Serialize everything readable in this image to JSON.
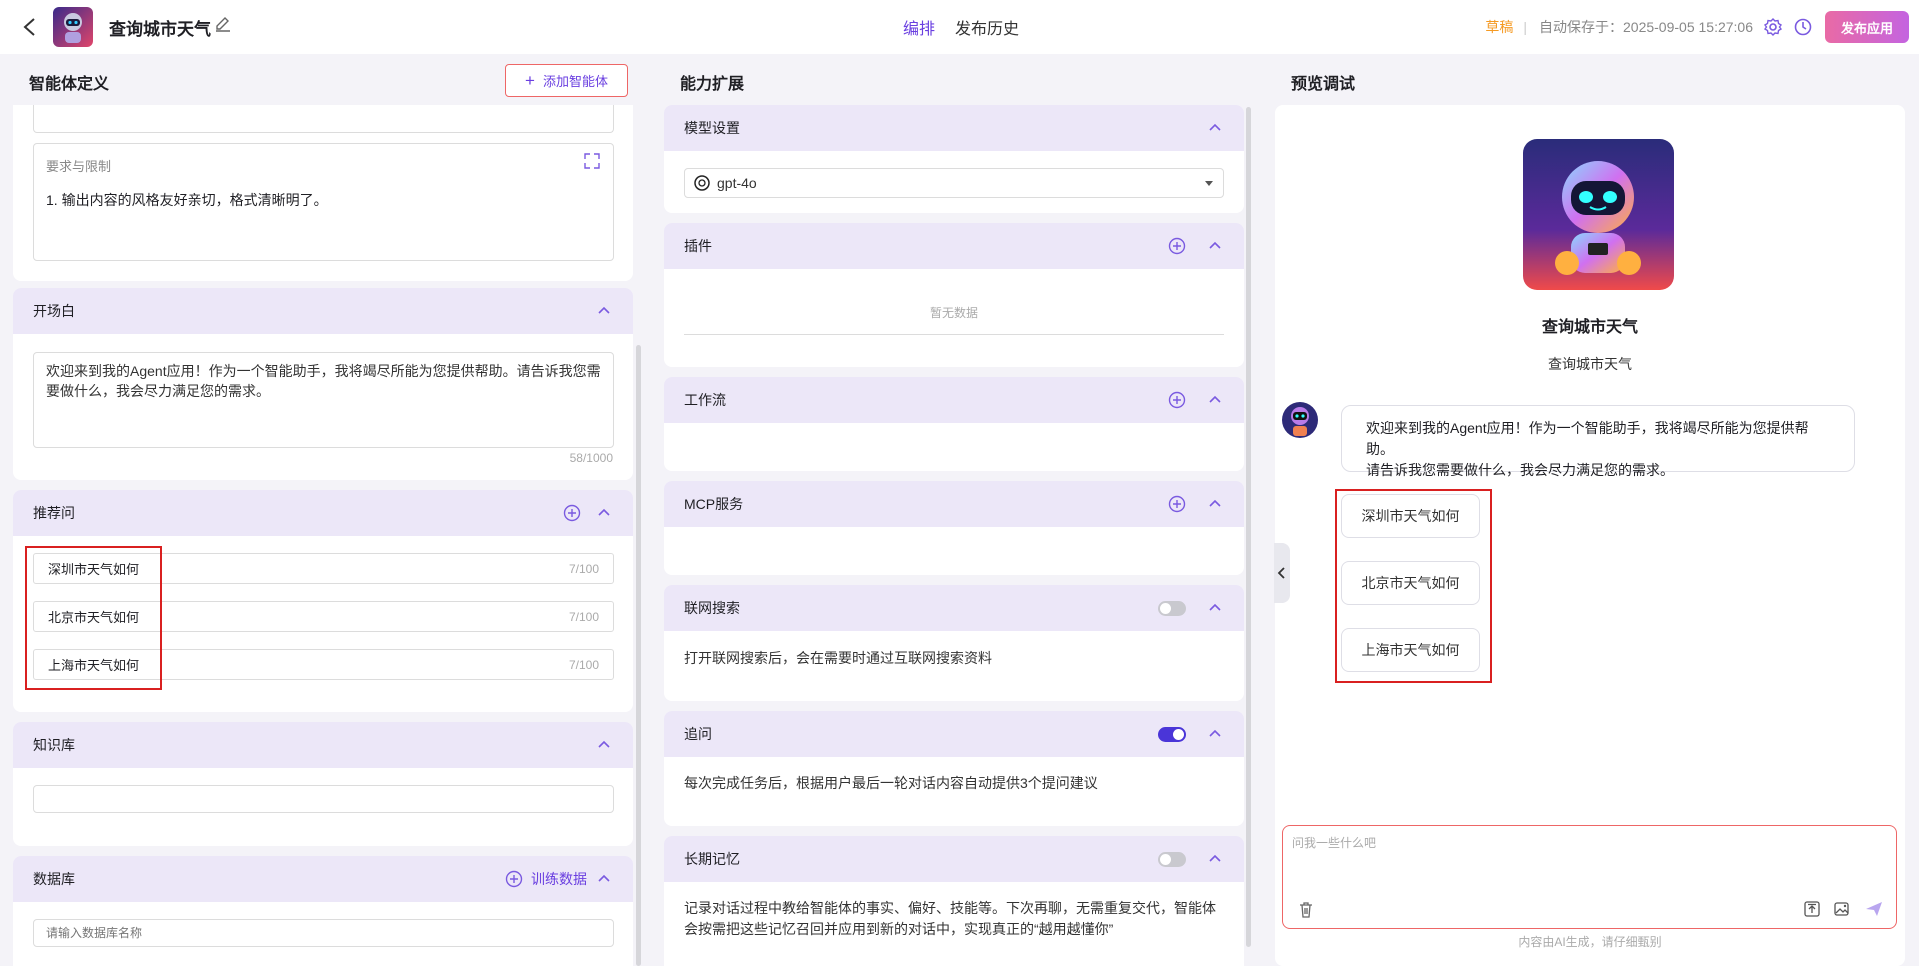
{
  "header": {
    "app_title": "查询城市天气",
    "tabs": [
      {
        "label": "编排",
        "active": true
      },
      {
        "label": "发布历史",
        "active": false
      }
    ],
    "draft": "草稿",
    "separator": "|",
    "autosave": "自动保存于：2025-09-05 15:27:06",
    "publish": "发布应用"
  },
  "left": {
    "title": "智能体定义",
    "add_agent": "添加智能体",
    "requirements_label": "要求与限制",
    "requirements_text": "1. 输出内容的风格友好亲切，格式清晰明了。",
    "opening": {
      "title": "开场白",
      "text": "欢迎来到我的Agent应用！作为一个智能助手，我将竭尽所能为您提供帮助。请告诉我您需要做什么，我会尽力满足您的需求。",
      "count": "58/1000"
    },
    "suggest": {
      "title": "推荐问",
      "items": [
        {
          "text": "深圳市天气如何",
          "count": "7/100"
        },
        {
          "text": "北京市天气如何",
          "count": "7/100"
        },
        {
          "text": "上海市天气如何",
          "count": "7/100"
        }
      ]
    },
    "knowledge": {
      "title": "知识库"
    },
    "database": {
      "title": "数据库",
      "train": "训练数据",
      "placeholder": "请输入数据库名称"
    }
  },
  "middle": {
    "title": "能力扩展",
    "model": {
      "title": "模型设置",
      "value": "gpt-4o"
    },
    "plugin": {
      "title": "插件",
      "empty": "暂无数据"
    },
    "workflow": {
      "title": "工作流"
    },
    "mcp": {
      "title": "MCP服务"
    },
    "web_search": {
      "title": "联网搜索",
      "enabled": false,
      "desc": "打开联网搜索后，会在需要时通过互联网搜索资料"
    },
    "followup": {
      "title": "追问",
      "enabled": true,
      "desc": "每次完成任务后，根据用户最后一轮对话内容自动提供3个提问建议"
    },
    "memory": {
      "title": "长期记忆",
      "enabled": false,
      "desc_line1": "记录对话过程中教给智能体的事实、偏好、技能等。下次再聊，无需重复交代，智能体",
      "desc_line2": "会按需把这些记忆召回并应用到新的对话中，实现真正的“越用越懂你”"
    }
  },
  "preview": {
    "title": "预览调试",
    "name": "查询城市天气",
    "subtitle": "查询城市天气",
    "message_line1": "欢迎来到我的Agent应用！作为一个智能助手，我将竭尽所能为您提供帮助。",
    "message_line2": "请告诉我您需要做什么，我会尽力满足您的需求。",
    "chips": [
      "深圳市天气如何",
      "北京市天气如何",
      "上海市天气如何"
    ],
    "input_placeholder": "问我一些什么吧",
    "footer": "内容由AI生成，请仔细甄别"
  },
  "colors": {
    "accent": "#6a3fe0",
    "draft": "#f59a23",
    "highlight": "#d92020",
    "panel_head": "#ece7f8"
  }
}
